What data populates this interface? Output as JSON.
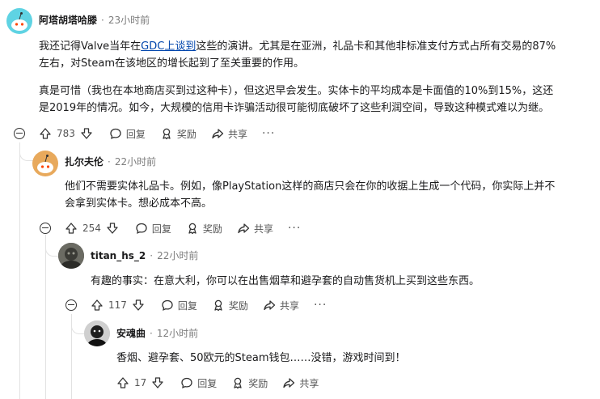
{
  "comments": [
    {
      "author": "阿塔胡塔哈滕",
      "time": "23小时前",
      "para1_a": "我还记得Valve当年在",
      "para1_link": "GDC上谈到",
      "para1_b": "这些的演讲。尤其是在亚洲，礼品卡和其他非标准支付方式占所有交易的87%",
      "para1_c": "左右，对Steam在该地区的增长起到了至关重要的作用。",
      "para2_a": "真是可惜（我也在本地商店买到过这种卡），但这迟早会发生。实体卡的平均成本是卡面值的10%到15%，这还",
      "para2_b": "是2019年的情况。如今，大规模的信用卡诈骗活动很可能彻底破坏了这些利润空间，导致这种模式难以为继。",
      "votes": "783",
      "reply": "回复",
      "award": "奖励",
      "share": "共享",
      "more": "···"
    },
    {
      "author": "扎尔夫伦",
      "time": "22小时前",
      "line1": "他们不需要实体礼品卡。例如，像PlayStation这样的商店只会在你的收据上生成一个代码，你实际上并不",
      "line2": "会拿到实体卡。想必成本不高。",
      "votes": "254",
      "reply": "回复",
      "award": "奖励",
      "share": "共享",
      "more": "···"
    },
    {
      "author": "titan_hs_2",
      "time": "22小时前",
      "line1": "有趣的事实：在意大利，你可以在出售烟草和避孕套的自动售货机上买到这些东西。",
      "votes": "117",
      "reply": "回复",
      "award": "奖励",
      "share": "共享",
      "more": "···"
    },
    {
      "author": "安魂曲",
      "time": "12小时前",
      "line1": "香烟、避孕套、50欧元的Steam钱包……没错，游戏时间到！",
      "votes": "17",
      "reply": "回复",
      "award": "奖励",
      "share": "共享"
    }
  ],
  "icons": {
    "upvote": "upvote-icon",
    "downvote": "downvote-icon",
    "reply": "comment-bubble-icon",
    "award": "award-icon",
    "share": "share-arrow-icon",
    "collapse": "collapse-icon"
  },
  "colors": {
    "link": "#0045ac",
    "avatar1": "#5fd3e3",
    "avatar2": "#e8a95c"
  }
}
